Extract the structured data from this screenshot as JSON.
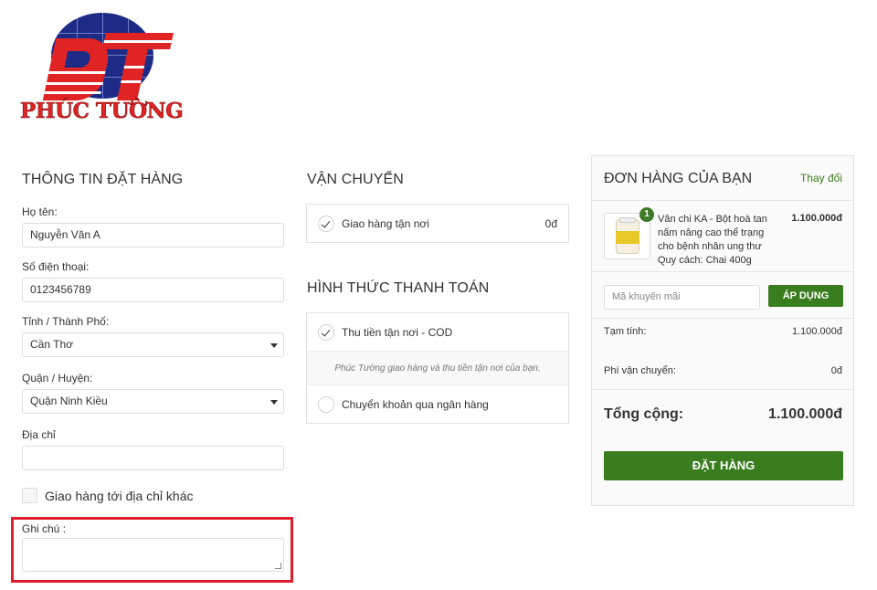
{
  "brand": {
    "name": "PHÚC TƯỜNG",
    "accent": "#e02424",
    "navy": "#1d2b86",
    "green": "#3a7d1f"
  },
  "checkout": {
    "title": "THÔNG TIN ĐẶT HÀNG",
    "fields": {
      "name": {
        "label": "Họ tên:",
        "value": "Nguyễn Văn A"
      },
      "phone": {
        "label": "Số điện thoại:",
        "value": "0123456789"
      },
      "province": {
        "label": "Tỉnh / Thành Phố:",
        "value": "Cần Thơ"
      },
      "district": {
        "label": "Quận / Huyện:",
        "value": "Quận Ninh Kiều"
      },
      "address": {
        "label": "Địa chỉ",
        "value": ""
      }
    },
    "ship_other": "Giao hàng tới địa chỉ khác",
    "note_label": "Ghi chú :"
  },
  "shipping": {
    "title": "VẬN CHUYỂN",
    "option": "Giao hàng tận nơi",
    "price": "0đ"
  },
  "payment": {
    "title": "HÌNH THỨC THANH TOÁN",
    "options": [
      {
        "label": "Thu tiền tận nơi - COD",
        "selected": true
      },
      {
        "label": "Chuyển khoản qua ngân hàng",
        "selected": false
      }
    ],
    "cod_note": "Phúc Tường giao hàng và thu tiền tận nơi của bạn."
  },
  "order": {
    "title": "ĐƠN HÀNG CỦA BẠN",
    "edit": "Thay đổi",
    "item": {
      "qty": "1",
      "name": "Vân chi KA - Bột hoà tan nấm nâng cao thể trạng cho bệnh nhân ung thư",
      "spec": "Quy cách: Chai 400g",
      "price": "1.100.000đ"
    },
    "coupon_placeholder": "Mã khuyến mãi",
    "apply": "ÁP DỤNG",
    "subtotal_label": "Tạm tính:",
    "subtotal": "1.100.000đ",
    "shipping_label": "Phí vận chuyển:",
    "shipping_fee": "0đ",
    "total_label": "Tổng cộng:",
    "total": "1.100.000đ",
    "place_order": "ĐẶT HÀNG"
  }
}
